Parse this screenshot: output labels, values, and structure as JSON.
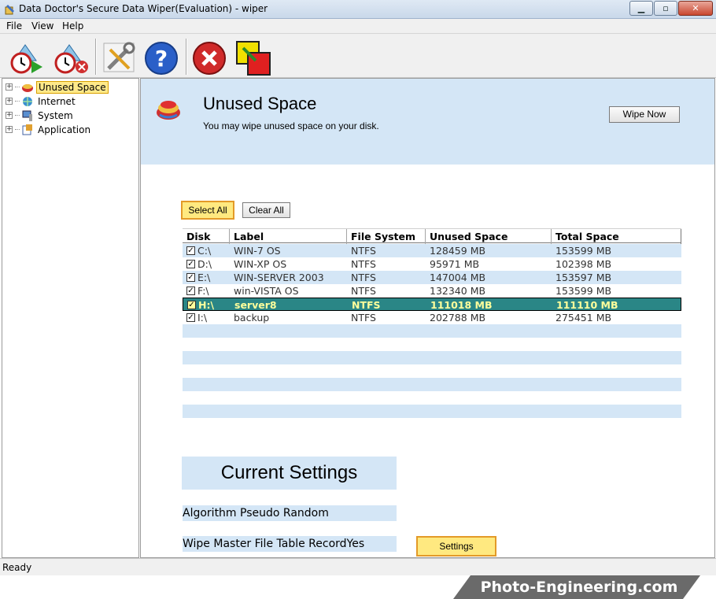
{
  "window": {
    "title": "Data Doctor's Secure Data Wiper(Evaluation) - wiper"
  },
  "menu": [
    "File",
    "View",
    "Help"
  ],
  "toolbar": [
    {
      "name": "wipe-schedule-icon"
    },
    {
      "name": "cancel-schedule-icon"
    },
    {
      "name": "settings-tools-icon"
    },
    {
      "name": "help-icon"
    },
    {
      "name": "exit-icon"
    },
    {
      "name": "switch-icon"
    }
  ],
  "tree": [
    {
      "label": "Unused Space",
      "selected": true
    },
    {
      "label": "Internet"
    },
    {
      "label": "System"
    },
    {
      "label": "Application"
    }
  ],
  "banner": {
    "title": "Unused Space",
    "subtitle": "You may wipe unused space on your disk.",
    "wipe_button": "Wipe Now"
  },
  "buttons": {
    "select_all": "Select All",
    "clear_all": "Clear All",
    "settings": "Settings"
  },
  "table": {
    "columns": [
      "Disk",
      "Label",
      "File System",
      "Unused Space",
      "Total Space"
    ],
    "rows": [
      {
        "disk": "C:\\",
        "label": "WIN-7 OS",
        "fs": "NTFS",
        "unused": "128459 MB",
        "total": "153599 MB",
        "checked": true
      },
      {
        "disk": "D:\\",
        "label": "WIN-XP OS",
        "fs": "NTFS",
        "unused": "95971 MB",
        "total": "102398 MB",
        "checked": true
      },
      {
        "disk": "E:\\",
        "label": "WIN-SERVER 2003",
        "fs": "NTFS",
        "unused": "147004 MB",
        "total": "153597 MB",
        "checked": true
      },
      {
        "disk": "F:\\",
        "label": "win-VISTA OS",
        "fs": "NTFS",
        "unused": "132340 MB",
        "total": "153599 MB",
        "checked": true
      },
      {
        "disk": "H:\\",
        "label": "server8",
        "fs": "NTFS",
        "unused": "111018 MB",
        "total": "111110 MB",
        "checked": true,
        "selected": true
      },
      {
        "disk": "I:\\",
        "label": "backup",
        "fs": "NTFS",
        "unused": "202788 MB",
        "total": "275451 MB",
        "checked": true
      }
    ]
  },
  "settings": {
    "title": "Current Settings",
    "algorithm": "Algorithm Pseudo Random",
    "mft": "Wipe Master File Table RecordYes"
  },
  "status": {
    "text": "Ready"
  },
  "watermark": {
    "text": "Photo-Engineering.com"
  }
}
